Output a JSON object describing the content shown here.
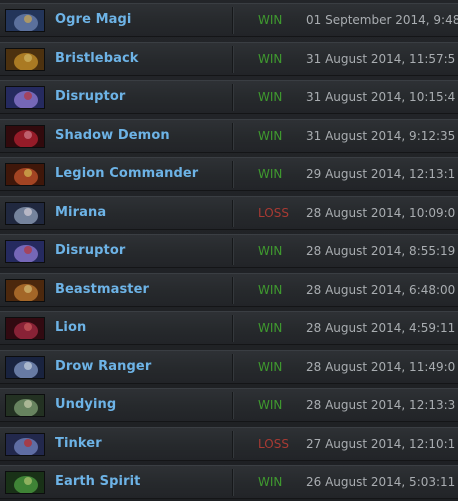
{
  "colors": {
    "hero_name": "#6db3e6",
    "win": "#3f9a2f",
    "loss": "#a83a33",
    "date": "#a9adb1"
  },
  "matches": [
    {
      "hero": "Ogre Magi",
      "result": "WIN",
      "date": "01 September 2014, 9:48",
      "portrait": {
        "bg": "#2a3f6a",
        "fg": "#6b84b8",
        "accent": "#c9b27a"
      }
    },
    {
      "hero": "Bristleback",
      "result": "WIN",
      "date": "31 August 2014, 11:57:5",
      "portrait": {
        "bg": "#5a3a12",
        "fg": "#c8902a",
        "accent": "#e8c260"
      }
    },
    {
      "hero": "Disruptor",
      "result": "WIN",
      "date": "31 August 2014, 10:15:4",
      "portrait": {
        "bg": "#2c3270",
        "fg": "#8a7ad8",
        "accent": "#c05070"
      }
    },
    {
      "hero": "Shadow Demon",
      "result": "WIN",
      "date": "31 August 2014, 9:12:35",
      "portrait": {
        "bg": "#3a0c10",
        "fg": "#b02030",
        "accent": "#e07080"
      }
    },
    {
      "hero": "Legion Commander",
      "result": "WIN",
      "date": "29 August 2014, 12:13:1",
      "portrait": {
        "bg": "#4a1c0c",
        "fg": "#c0502a",
        "accent": "#e8b050"
      }
    },
    {
      "hero": "Mirana",
      "result": "LOSS",
      "date": "28 August 2014, 10:09:0",
      "portrait": {
        "bg": "#26304a",
        "fg": "#8a9ab8",
        "accent": "#d8d8e8"
      }
    },
    {
      "hero": "Disruptor",
      "result": "WIN",
      "date": "28 August 2014, 8:55:19",
      "portrait": {
        "bg": "#2c3270",
        "fg": "#8a7ad8",
        "accent": "#c05070"
      }
    },
    {
      "hero": "Beastmaster",
      "result": "WIN",
      "date": "28 August 2014, 6:48:00",
      "portrait": {
        "bg": "#5a3010",
        "fg": "#c07830",
        "accent": "#e8c070"
      }
    },
    {
      "hero": "Lion",
      "result": "WIN",
      "date": "28 August 2014, 4:59:11",
      "portrait": {
        "bg": "#3a0c14",
        "fg": "#a02840",
        "accent": "#d85860"
      }
    },
    {
      "hero": "Drow Ranger",
      "result": "WIN",
      "date": "28 August 2014, 11:49:0",
      "portrait": {
        "bg": "#1e2a4a",
        "fg": "#7a90c0",
        "accent": "#c8d8f0"
      }
    },
    {
      "hero": "Undying",
      "result": "WIN",
      "date": "28 August 2014, 12:13:3",
      "portrait": {
        "bg": "#2a3a28",
        "fg": "#7a9a70",
        "accent": "#c8d8b0"
      }
    },
    {
      "hero": "Tinker",
      "result": "LOSS",
      "date": "27 August 2014, 12:10:1",
      "portrait": {
        "bg": "#28305a",
        "fg": "#7080c0",
        "accent": "#c04858"
      }
    },
    {
      "hero": "Earth Spirit",
      "result": "WIN",
      "date": "26 August 2014, 5:03:11",
      "portrait": {
        "bg": "#1e3a1c",
        "fg": "#4a9a40",
        "accent": "#a8d070"
      }
    }
  ]
}
